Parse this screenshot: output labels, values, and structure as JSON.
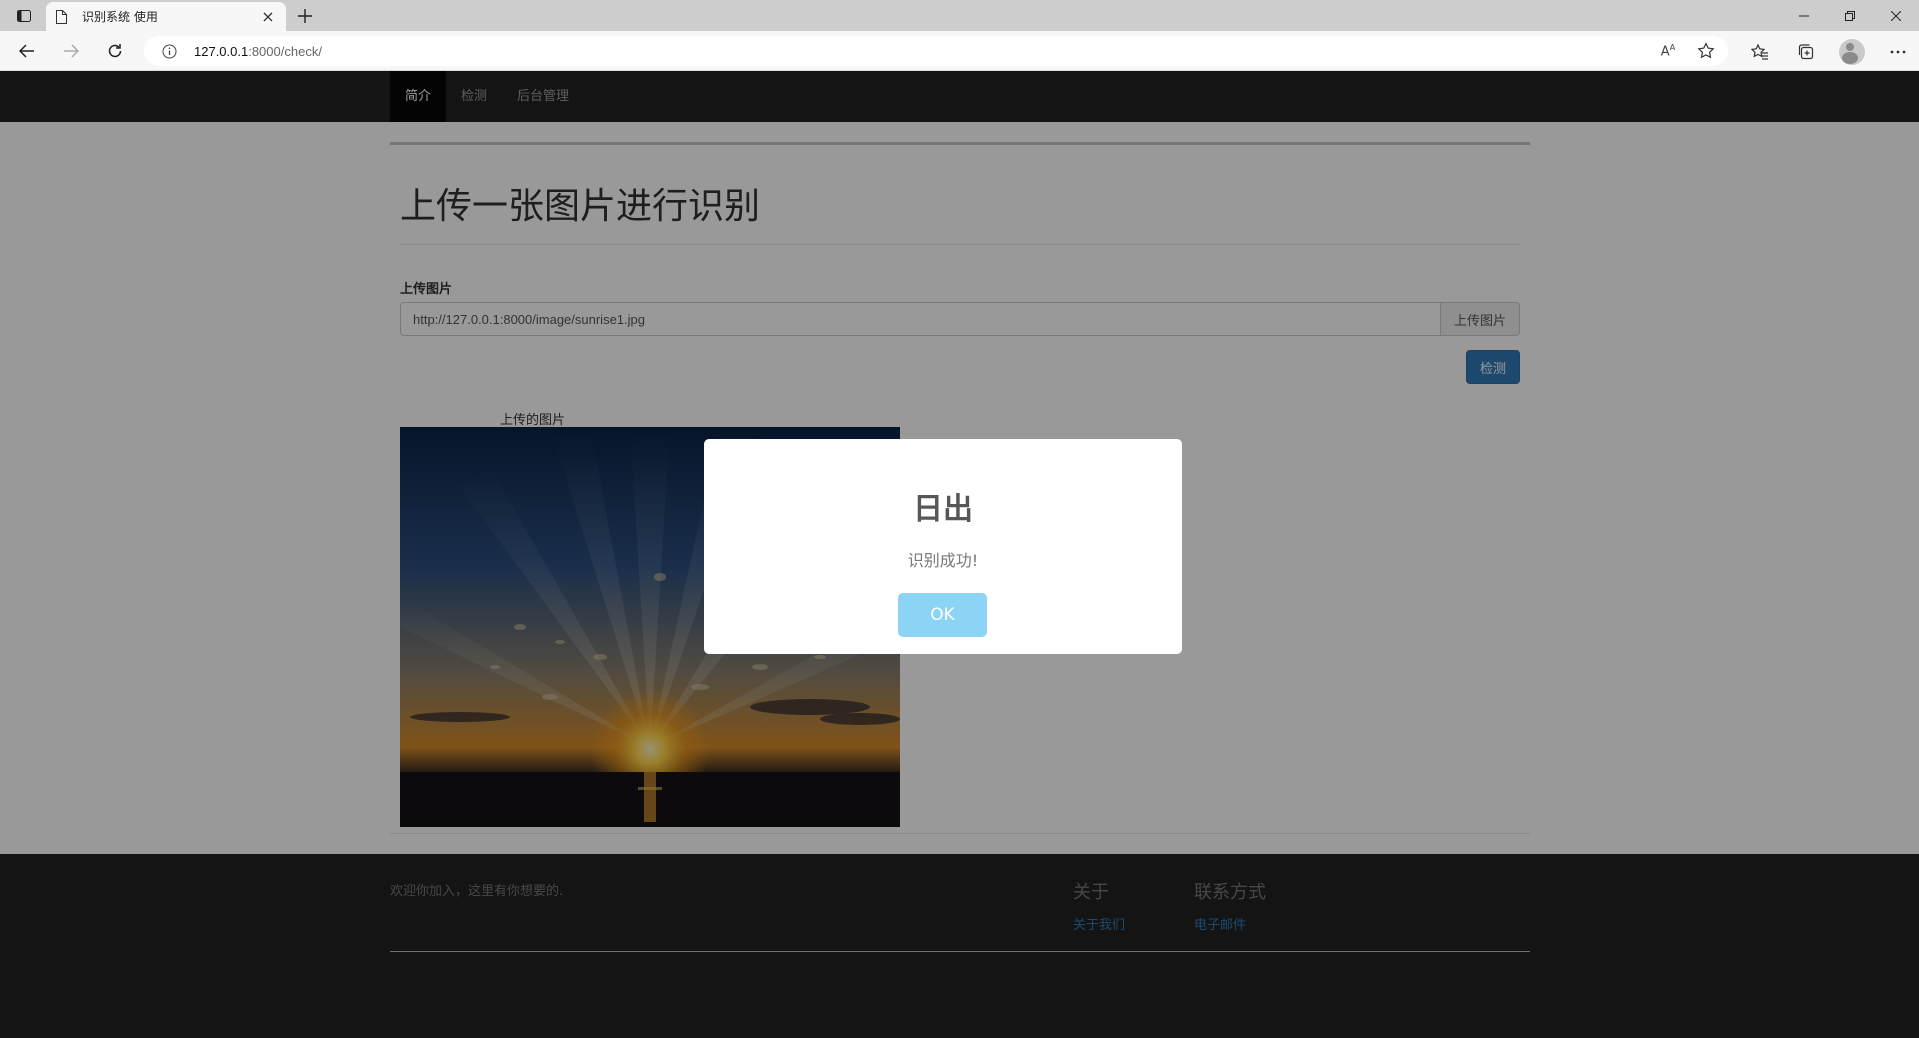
{
  "browser": {
    "tab_title": "识别系统 使用",
    "url_host": "127.0.0.1",
    "url_rest": ":8000/check/"
  },
  "nav": {
    "items": [
      {
        "label": "简介",
        "active": true
      },
      {
        "label": "检测",
        "active": false
      },
      {
        "label": "后台管理",
        "active": false
      }
    ]
  },
  "main": {
    "title": "上传一张图片进行识别",
    "field_label": "上传图片",
    "image_url_value": "http://127.0.0.1:8000/image/sunrise1.jpg",
    "upload_button": "上传图片",
    "detect_button": "检测",
    "image_caption": "上传的图片"
  },
  "footer": {
    "tagline": "欢迎你加入，这里有你想要的.",
    "about_heading": "关于",
    "about_link": "关于我们",
    "contact_heading": "联系方式",
    "contact_link": "电子邮件"
  },
  "modal": {
    "title": "日出",
    "text": "识别成功!",
    "ok_button": "OK"
  },
  "colors": {
    "nav_bg": "#222222",
    "primary": "#337ab7",
    "ok_button": "#8cd4f5"
  }
}
